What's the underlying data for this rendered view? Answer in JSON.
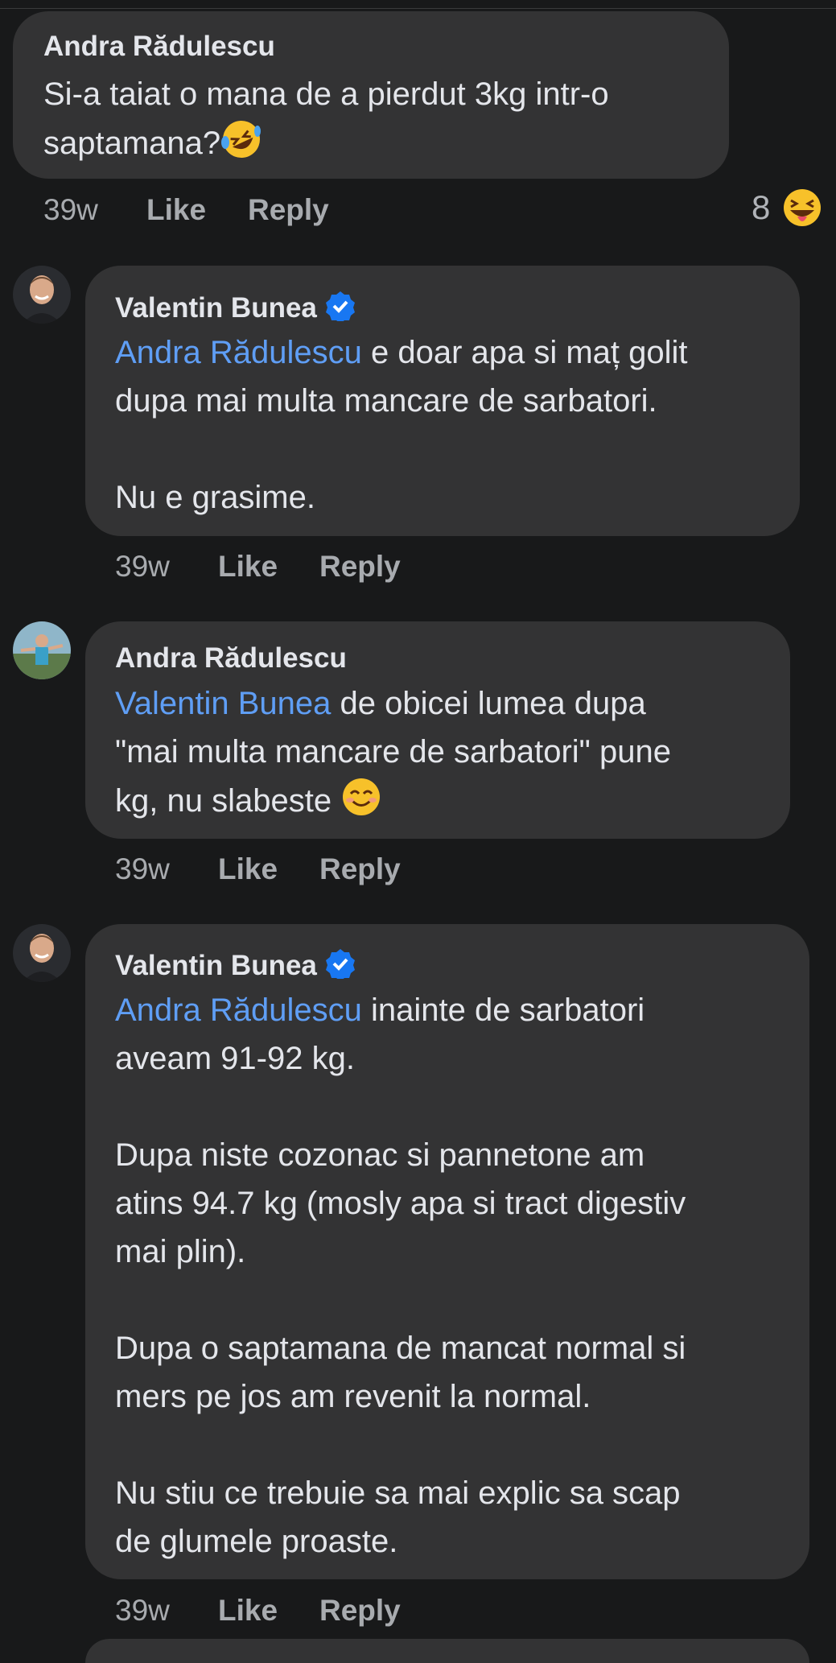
{
  "comments": [
    {
      "author": "Andra Rădulescu",
      "text": "Si-a taiat o mana de a pierdut 3kg intr-o\nsaptamana?",
      "emoji": "rolling-on-floor-laughing-emoji",
      "time": "39w",
      "like": "Like",
      "reply": "Reply",
      "reaction_count": "8",
      "reaction_emoji": "grinning-squinting-tongue-emoji"
    },
    {
      "author": "Valentin Bunea",
      "verified": true,
      "mention": "Andra Rădulescu",
      "text": " e doar apa si maț golit\ndupa mai multa mancare de sarbatori.\n\nNu e grasime.",
      "time": "39w",
      "like": "Like",
      "reply": "Reply"
    },
    {
      "author": "Andra Rădulescu",
      "mention": "Valentin Bunea",
      "text": " de obicei lumea dupa\n\"mai multa mancare de sarbatori\" pune\nkg, nu slabeste ",
      "emoji": "smiling-face-emoji",
      "time": "39w",
      "like": "Like",
      "reply": "Reply"
    },
    {
      "author": "Valentin Bunea",
      "verified": true,
      "mention": "Andra Rădulescu",
      "text": " inainte de sarbatori\naveam 91-92 kg.\n\nDupa niste cozonac si pannetone am\natins 94.7 kg (mosly apa si tract digestiv\nmai plin).\n\nDupa o saptamana de mancat normal si\nmers pe jos am revenit la normal.\n\nNu stiu ce trebuie sa mai explic sa scap\nde glumele proaste.",
      "time": "39w",
      "like": "Like",
      "reply": "Reply"
    }
  ],
  "colors": {
    "background": "#18191a",
    "bubble": "#333334",
    "mention": "#5f9ef5",
    "meta": "#a8abaf",
    "verified": "#1877f2"
  }
}
